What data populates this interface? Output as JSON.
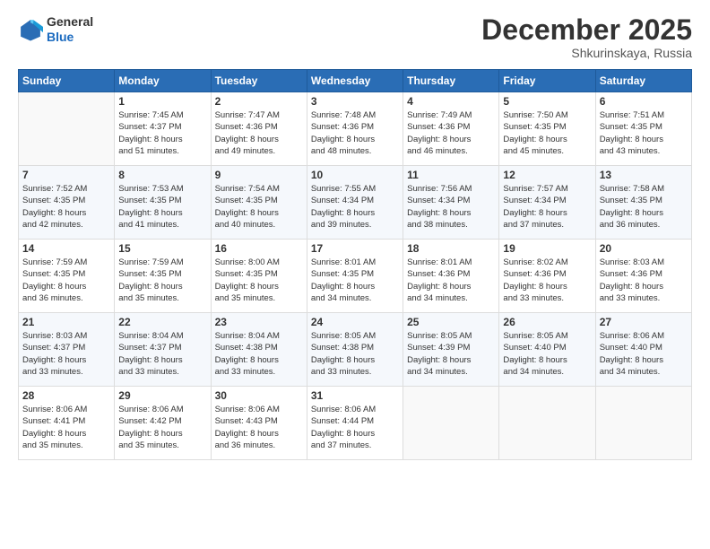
{
  "header": {
    "logo_line1": "General",
    "logo_line2": "Blue",
    "month": "December 2025",
    "location": "Shkurinskaya, Russia"
  },
  "weekdays": [
    "Sunday",
    "Monday",
    "Tuesday",
    "Wednesday",
    "Thursday",
    "Friday",
    "Saturday"
  ],
  "weeks": [
    [
      {
        "day": "",
        "info": ""
      },
      {
        "day": "1",
        "info": "Sunrise: 7:45 AM\nSunset: 4:37 PM\nDaylight: 8 hours\nand 51 minutes."
      },
      {
        "day": "2",
        "info": "Sunrise: 7:47 AM\nSunset: 4:36 PM\nDaylight: 8 hours\nand 49 minutes."
      },
      {
        "day": "3",
        "info": "Sunrise: 7:48 AM\nSunset: 4:36 PM\nDaylight: 8 hours\nand 48 minutes."
      },
      {
        "day": "4",
        "info": "Sunrise: 7:49 AM\nSunset: 4:36 PM\nDaylight: 8 hours\nand 46 minutes."
      },
      {
        "day": "5",
        "info": "Sunrise: 7:50 AM\nSunset: 4:35 PM\nDaylight: 8 hours\nand 45 minutes."
      },
      {
        "day": "6",
        "info": "Sunrise: 7:51 AM\nSunset: 4:35 PM\nDaylight: 8 hours\nand 43 minutes."
      }
    ],
    [
      {
        "day": "7",
        "info": "Sunrise: 7:52 AM\nSunset: 4:35 PM\nDaylight: 8 hours\nand 42 minutes."
      },
      {
        "day": "8",
        "info": "Sunrise: 7:53 AM\nSunset: 4:35 PM\nDaylight: 8 hours\nand 41 minutes."
      },
      {
        "day": "9",
        "info": "Sunrise: 7:54 AM\nSunset: 4:35 PM\nDaylight: 8 hours\nand 40 minutes."
      },
      {
        "day": "10",
        "info": "Sunrise: 7:55 AM\nSunset: 4:34 PM\nDaylight: 8 hours\nand 39 minutes."
      },
      {
        "day": "11",
        "info": "Sunrise: 7:56 AM\nSunset: 4:34 PM\nDaylight: 8 hours\nand 38 minutes."
      },
      {
        "day": "12",
        "info": "Sunrise: 7:57 AM\nSunset: 4:34 PM\nDaylight: 8 hours\nand 37 minutes."
      },
      {
        "day": "13",
        "info": "Sunrise: 7:58 AM\nSunset: 4:35 PM\nDaylight: 8 hours\nand 36 minutes."
      }
    ],
    [
      {
        "day": "14",
        "info": "Sunrise: 7:59 AM\nSunset: 4:35 PM\nDaylight: 8 hours\nand 36 minutes."
      },
      {
        "day": "15",
        "info": "Sunrise: 7:59 AM\nSunset: 4:35 PM\nDaylight: 8 hours\nand 35 minutes."
      },
      {
        "day": "16",
        "info": "Sunrise: 8:00 AM\nSunset: 4:35 PM\nDaylight: 8 hours\nand 35 minutes."
      },
      {
        "day": "17",
        "info": "Sunrise: 8:01 AM\nSunset: 4:35 PM\nDaylight: 8 hours\nand 34 minutes."
      },
      {
        "day": "18",
        "info": "Sunrise: 8:01 AM\nSunset: 4:36 PM\nDaylight: 8 hours\nand 34 minutes."
      },
      {
        "day": "19",
        "info": "Sunrise: 8:02 AM\nSunset: 4:36 PM\nDaylight: 8 hours\nand 33 minutes."
      },
      {
        "day": "20",
        "info": "Sunrise: 8:03 AM\nSunset: 4:36 PM\nDaylight: 8 hours\nand 33 minutes."
      }
    ],
    [
      {
        "day": "21",
        "info": "Sunrise: 8:03 AM\nSunset: 4:37 PM\nDaylight: 8 hours\nand 33 minutes."
      },
      {
        "day": "22",
        "info": "Sunrise: 8:04 AM\nSunset: 4:37 PM\nDaylight: 8 hours\nand 33 minutes."
      },
      {
        "day": "23",
        "info": "Sunrise: 8:04 AM\nSunset: 4:38 PM\nDaylight: 8 hours\nand 33 minutes."
      },
      {
        "day": "24",
        "info": "Sunrise: 8:05 AM\nSunset: 4:38 PM\nDaylight: 8 hours\nand 33 minutes."
      },
      {
        "day": "25",
        "info": "Sunrise: 8:05 AM\nSunset: 4:39 PM\nDaylight: 8 hours\nand 34 minutes."
      },
      {
        "day": "26",
        "info": "Sunrise: 8:05 AM\nSunset: 4:40 PM\nDaylight: 8 hours\nand 34 minutes."
      },
      {
        "day": "27",
        "info": "Sunrise: 8:06 AM\nSunset: 4:40 PM\nDaylight: 8 hours\nand 34 minutes."
      }
    ],
    [
      {
        "day": "28",
        "info": "Sunrise: 8:06 AM\nSunset: 4:41 PM\nDaylight: 8 hours\nand 35 minutes."
      },
      {
        "day": "29",
        "info": "Sunrise: 8:06 AM\nSunset: 4:42 PM\nDaylight: 8 hours\nand 35 minutes."
      },
      {
        "day": "30",
        "info": "Sunrise: 8:06 AM\nSunset: 4:43 PM\nDaylight: 8 hours\nand 36 minutes."
      },
      {
        "day": "31",
        "info": "Sunrise: 8:06 AM\nSunset: 4:44 PM\nDaylight: 8 hours\nand 37 minutes."
      },
      {
        "day": "",
        "info": ""
      },
      {
        "day": "",
        "info": ""
      },
      {
        "day": "",
        "info": ""
      }
    ]
  ]
}
